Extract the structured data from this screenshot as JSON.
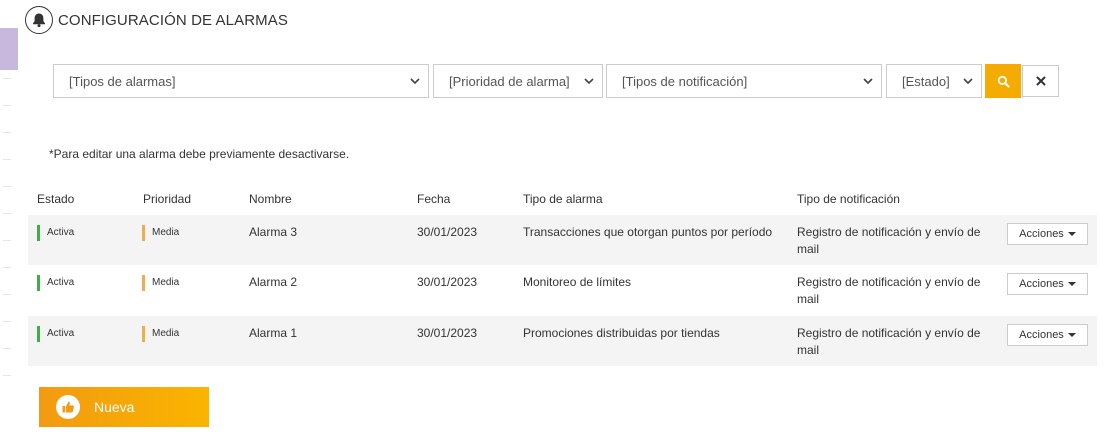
{
  "header": {
    "title": "CONFIGURACIÓN DE ALARMAS",
    "icon": "bell-icon"
  },
  "filters": {
    "alarm_types": "[Tipos de alarmas]",
    "priority": "[Prioridad de alarma]",
    "notification_types": "[Tipos de notificación]",
    "status": "[Estado]"
  },
  "note": "*Para editar una alarma debe previamente desactivarse.",
  "table": {
    "columns": [
      "Estado",
      "Prioridad",
      "Nombre",
      "Fecha",
      "Tipo de alarma",
      "Tipo de notificación"
    ],
    "rows": [
      {
        "estado": "Activa",
        "prioridad": "Media",
        "nombre": "Alarma 3",
        "fecha": "30/01/2023",
        "tipo_alarma": "Transacciones que otorgan puntos por período",
        "tipo_notificacion": "Registro de notificación y envío de mail",
        "acciones": "Acciones"
      },
      {
        "estado": "Activa",
        "prioridad": "Media",
        "nombre": "Alarma 2",
        "fecha": "30/01/2023",
        "tipo_alarma": "Monitoreo de límites",
        "tipo_notificacion": "Registro de notificación y envío de mail",
        "acciones": "Acciones"
      },
      {
        "estado": "Activa",
        "prioridad": "Media",
        "nombre": "Alarma 1",
        "fecha": "30/01/2023",
        "tipo_alarma": "Promociones distribuidas por tiendas",
        "tipo_notificacion": "Registro de notificación y envío de mail",
        "acciones": "Acciones"
      }
    ]
  },
  "new_button": {
    "label": "Nueva"
  },
  "colors": {
    "accent": "#f4ac02",
    "status_active": "#3fae49",
    "priority_medium": "#f0ad4e",
    "sidebar_tab": "#c9b8dd"
  }
}
